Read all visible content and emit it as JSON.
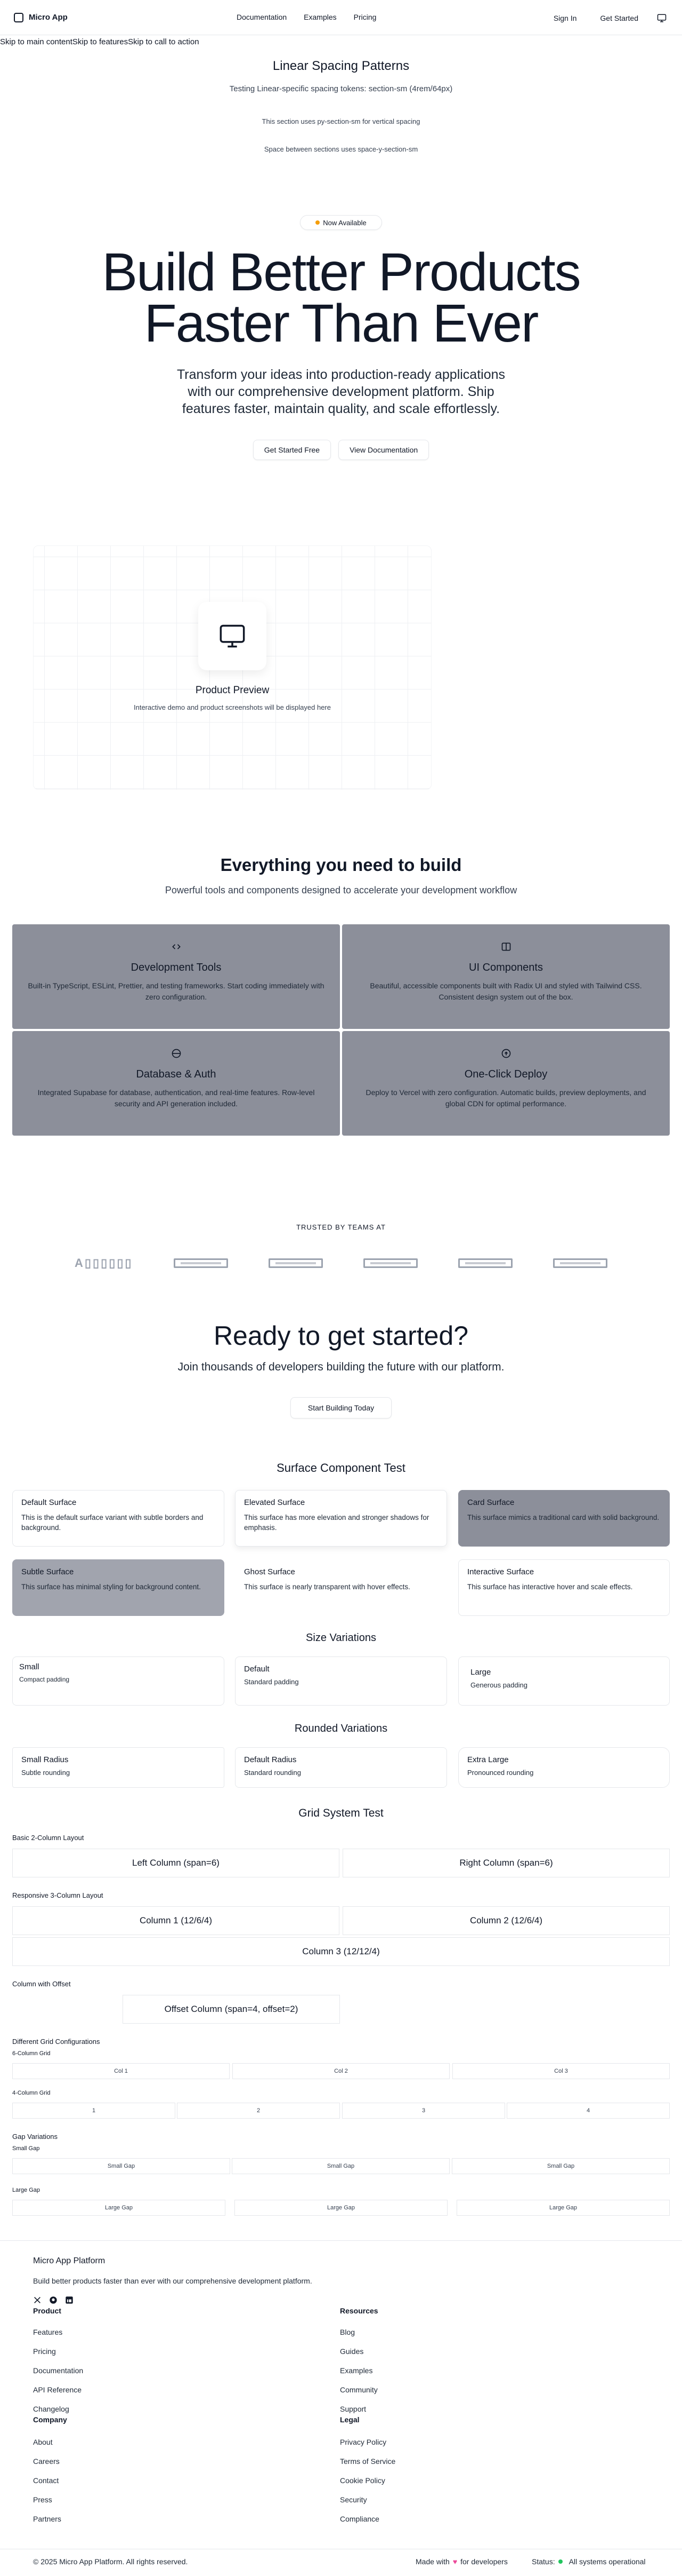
{
  "header": {
    "app_name": "Micro App",
    "nav": [
      "Documentation",
      "Examples",
      "Pricing"
    ],
    "sign_in": "Sign In",
    "get_started": "Get Started"
  },
  "skip_links": [
    "Skip to main content",
    "Skip to features",
    "Skip to call to action"
  ],
  "spacing": {
    "title": "Linear Spacing Patterns",
    "subtitle": "Testing Linear-specific spacing tokens: section-sm (4rem/64px)",
    "line_a": "This section uses py-section-sm for vertical spacing",
    "line_b": "Space between sections uses space-y-section-sm"
  },
  "hero": {
    "badge": "Now Available",
    "title_line1": "Build Better Products",
    "title_line2": "Faster Than Ever",
    "subtitle": "Transform your ideas into production-ready applications with our comprehensive development platform. Ship features faster, maintain quality, and scale effortlessly.",
    "btn_primary": "Get Started Free",
    "btn_secondary": "View Documentation"
  },
  "preview": {
    "title": "Product Preview",
    "subtitle": "Interactive demo and product screenshots will be displayed here"
  },
  "features": {
    "title": "Everything you need to build",
    "subtitle": "Powerful tools and components designed to accelerate your development workflow",
    "items": [
      {
        "icon": "code-icon",
        "title": "Development Tools",
        "desc": "Built-in TypeScript, ESLint, Prettier, and testing frameworks. Start coding immediately with zero configuration."
      },
      {
        "icon": "columns-icon",
        "title": "UI Components",
        "desc": "Beautiful, accessible components built with Radix UI and styled with Tailwind CSS. Consistent design system out of the box."
      },
      {
        "icon": "database-icon",
        "title": "Database & Auth",
        "desc": "Integrated Supabase for database, authentication, and real-time features. Row-level security and API generation included."
      },
      {
        "icon": "cloud-upload-icon",
        "title": "One-Click Deploy",
        "desc": "Deploy to Vercel with zero configuration. Automatic builds, preview deployments, and global CDN for optimal performance."
      }
    ]
  },
  "trusted": {
    "label": "TRUSTED BY TEAMS AT",
    "first_logo": "A▯▯▯▯▯▯"
  },
  "cta": {
    "title": "Ready to get started?",
    "subtitle": "Join thousands of developers building the future with our platform.",
    "button": "Start Building Today"
  },
  "surface": {
    "title": "Surface Component Test",
    "cards": [
      {
        "title": "Default Surface",
        "desc": "This is the default surface variant with subtle borders and background."
      },
      {
        "title": "Elevated Surface",
        "desc": "This surface has more elevation and stronger shadows for emphasis."
      },
      {
        "title": "Card Surface",
        "desc": "This surface mimics a traditional card with solid background."
      },
      {
        "title": "Subtle Surface",
        "desc": "This surface has minimal styling for background content."
      },
      {
        "title": "Ghost Surface",
        "desc": "This surface is nearly transparent with hover effects."
      },
      {
        "title": "Interactive Surface",
        "desc": "This surface has interactive hover and scale effects."
      }
    ]
  },
  "sizes": {
    "title": "Size Variations",
    "items": [
      {
        "title": "Small",
        "desc": "Compact padding"
      },
      {
        "title": "Default",
        "desc": "Standard padding"
      },
      {
        "title": "Large",
        "desc": "Generous padding"
      }
    ]
  },
  "rounded": {
    "title": "Rounded Variations",
    "items": [
      {
        "title": "Small Radius",
        "desc": "Subtle rounding"
      },
      {
        "title": "Default Radius",
        "desc": "Standard rounding"
      },
      {
        "title": "Extra Large",
        "desc": "Pronounced rounding"
      }
    ]
  },
  "grid": {
    "title": "Grid System Test",
    "basic_label": "Basic 2-Column Layout",
    "basic": [
      "Left Column (span=6)",
      "Right Column (span=6)"
    ],
    "resp_label": "Responsive 3-Column Layout",
    "resp": [
      "Column 1 (12/6/4)",
      "Column 2 (12/6/4)",
      "Column 3 (12/12/4)"
    ],
    "offset_label": "Column with Offset",
    "offset": "Offset Column (span=4, offset=2)",
    "configs_label": "Different Grid Configurations",
    "six_label": "6-Column Grid",
    "six": [
      "Col 1",
      "Col 2",
      "Col 3"
    ],
    "four_label": "4-Column Grid",
    "four": [
      "1",
      "2",
      "3",
      "4"
    ],
    "gap_label": "Gap Variations",
    "small_gap_label": "Small Gap",
    "small_gap": [
      "Small Gap",
      "Small Gap",
      "Small Gap"
    ],
    "large_gap_label": "Large Gap",
    "large_gap": [
      "Large Gap",
      "Large Gap",
      "Large Gap"
    ]
  },
  "footer": {
    "brand": "Micro App Platform",
    "tagline": "Build better products faster than ever with our comprehensive development platform.",
    "social": [
      "x-icon",
      "github-icon",
      "linkedin-icon"
    ],
    "product_head": "Product",
    "product": [
      "Features",
      "Pricing",
      "Documentation",
      "API Reference",
      "Changelog"
    ],
    "resources_head": "Resources",
    "resources": [
      "Blog",
      "Guides",
      "Examples",
      "Community",
      "Support"
    ],
    "company_head": "Company",
    "company": [
      "About",
      "Careers",
      "Contact",
      "Press",
      "Partners"
    ],
    "legal_head": "Legal",
    "legal": [
      "Privacy Policy",
      "Terms of Service",
      "Cookie Policy",
      "Security",
      "Compliance"
    ],
    "copyright": "© 2025 Micro App Platform. All rights reserved.",
    "made_with_a": "Made with",
    "made_with_b": "for developers",
    "status_label": "Status:",
    "status_value": "All systems operational"
  }
}
